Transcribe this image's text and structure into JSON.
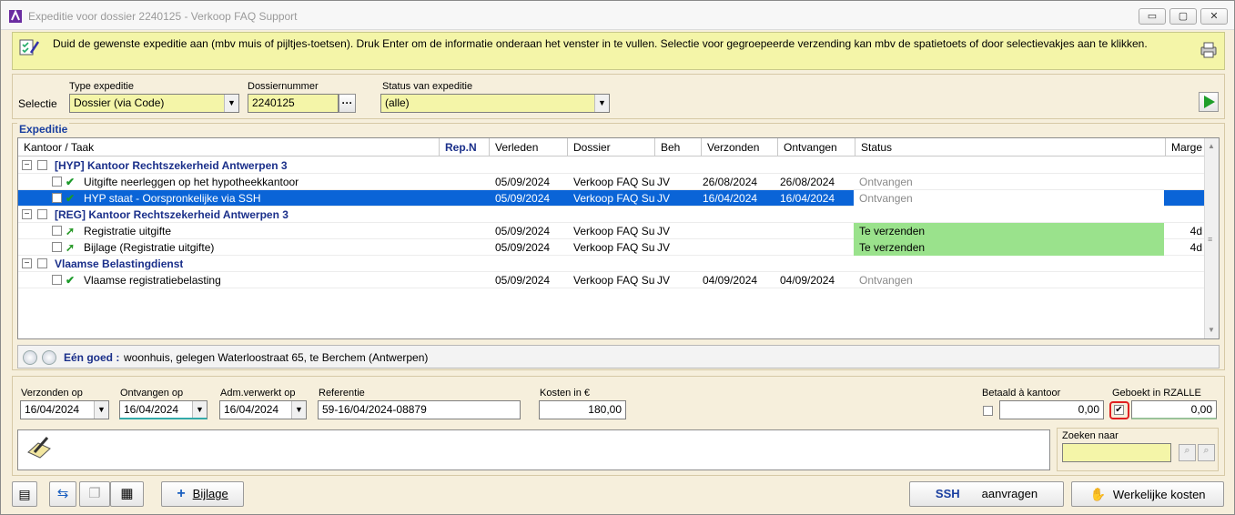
{
  "window": {
    "title": "Expeditie voor dossier 2240125 - Verkoop FAQ Support",
    "minimize": "▭",
    "restore": "▢",
    "close": "✕"
  },
  "info": {
    "text": "Duid de gewenste expeditie aan (mbv muis of pijltjes-toetsen). Druk Enter om de informatie onderaan het venster in te vullen. Selectie voor gegroepeerde verzending kan mbv de spatietoets of door selectievakjes aan te klikken."
  },
  "selectie": {
    "label": "Selectie",
    "type_label": "Type expeditie",
    "type_value": "Dossier (via Code)",
    "dossier_label": "Dossiernummer",
    "dossier_value": "2240125",
    "dossier_btn": "···",
    "status_label": "Status van expeditie",
    "status_value": "(alle)"
  },
  "expeditie": {
    "label": "Expeditie",
    "columns": [
      "Kantoor / Taak",
      "Rep.N",
      "Verleden",
      "Dossier",
      "Beh",
      "Verzonden",
      "Ontvangen",
      "Status",
      "Marge"
    ],
    "rows": [
      {
        "type": "group",
        "name": "[HYP] Kantoor Rechtszekerheid Antwerpen 3"
      },
      {
        "type": "task",
        "name": "Uitgifte neerleggen op het hypotheekkantoor",
        "verleden": "05/09/2024",
        "dossier": "Verkoop FAQ Sup",
        "beh": "JV",
        "verzonden": "26/08/2024",
        "ontvangen": "26/08/2024",
        "status": "Ontvangen",
        "marge": "",
        "icon": "check"
      },
      {
        "type": "task",
        "selected": true,
        "name": "HYP staat - Oorspronkelijke via SSH",
        "verleden": "05/09/2024",
        "dossier": "Verkoop FAQ Sup",
        "beh": "JV",
        "verzonden": "16/04/2024",
        "ontvangen": "16/04/2024",
        "status": "Ontvangen",
        "marge": "",
        "icon": "check"
      },
      {
        "type": "group",
        "name": "[REG] Kantoor Rechtszekerheid Antwerpen 3"
      },
      {
        "type": "task",
        "name": "Registratie uitgifte",
        "verleden": "05/09/2024",
        "dossier": "Verkoop FAQ Sup",
        "beh": "JV",
        "verzonden": "",
        "ontvangen": "",
        "status": "Te verzenden",
        "marge": "4d",
        "icon": "arrow"
      },
      {
        "type": "task",
        "name": "Bijlage (Registratie uitgifte)",
        "verleden": "05/09/2024",
        "dossier": "Verkoop FAQ Sup",
        "beh": "JV",
        "verzonden": "",
        "ontvangen": "",
        "status": "Te verzenden",
        "marge": "4d",
        "icon": "arrow"
      },
      {
        "type": "group",
        "name": "Vlaamse Belastingdienst"
      },
      {
        "type": "task",
        "name": "Vlaamse registratiebelasting",
        "verleden": "05/09/2024",
        "dossier": "Verkoop FAQ Sup",
        "beh": "JV",
        "verzonden": "04/09/2024",
        "ontvangen": "04/09/2024",
        "status": "Ontvangen",
        "marge": "",
        "icon": "check"
      }
    ]
  },
  "goed": {
    "label": "Eén goed :",
    "value": "woonhuis, gelegen Waterloostraat 65, te Berchem (Antwerpen)"
  },
  "detail": {
    "verzonden_label": "Verzonden op",
    "verzonden_value": "16/04/2024",
    "ontvangen_label": "Ontvangen op",
    "ontvangen_value": "16/04/2024",
    "adm_label": "Adm.verwerkt op",
    "adm_value": "16/04/2024",
    "ref_label": "Referentie",
    "ref_value": "59-16/04/2024-08879",
    "kosten_label": "Kosten in €",
    "kosten_value": "180,00",
    "betaald_label": "Betaald à kantoor",
    "betaald_value": "0,00",
    "geboekt_label": "Geboekt in RZALLE",
    "geboekt_value": "0,00",
    "zoeken_label": "Zoeken naar"
  },
  "footer": {
    "bijlage": "Bijlage",
    "ssh": "SSH",
    "aanvragen": "aanvragen",
    "kosten": "Werkelijke kosten"
  },
  "colors": {
    "accent": "#0a64d7",
    "info_bg": "#f4f5a8",
    "status_green": "#9ae28c",
    "group_text": "#1a2f8a"
  }
}
